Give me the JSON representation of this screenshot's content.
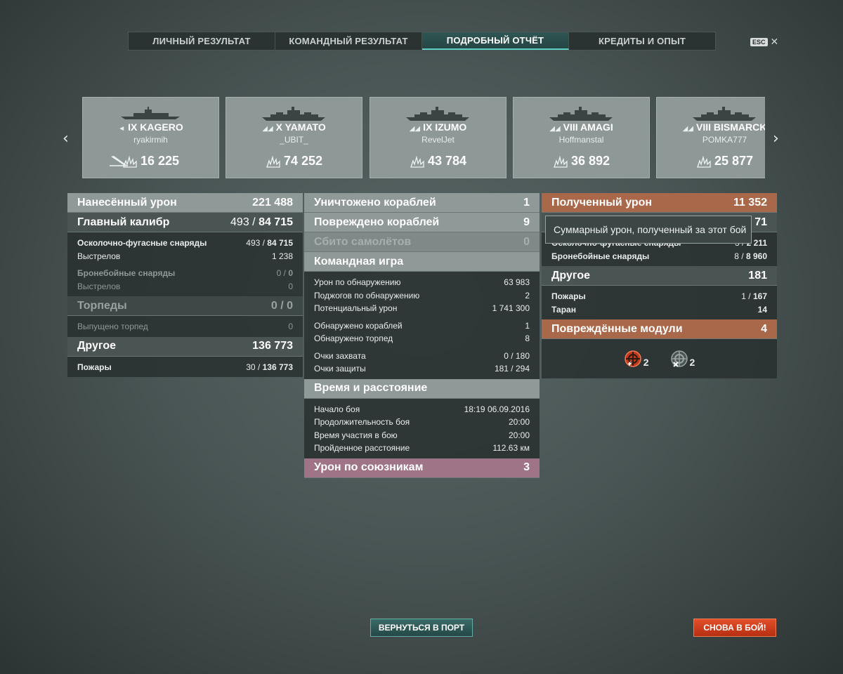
{
  "tabs": [
    "ЛИЧНЫЙ РЕЗУЛЬТАТ",
    "КОМАНДНЫЙ РЕЗУЛЬТАТ",
    "ПОДРОБНЫЙ ОТЧЁТ",
    "КРЕДИТЫ И ОПЫТ"
  ],
  "active_tab": "ПОДРОБНЫЙ ОТЧЁТ",
  "esc_label": "ESC",
  "cards": [
    {
      "tier": "IX",
      "name": "KAGERO",
      "player": "ryakirmih",
      "damage": "16 225",
      "icon": "destroyer-icon"
    },
    {
      "tier": "X",
      "name": "YAMATO",
      "player": "_UBIT_",
      "damage": "74 252",
      "icon": "battleship-icon"
    },
    {
      "tier": "IX",
      "name": "IZUMO",
      "player": "RevelJet",
      "damage": "43 784",
      "icon": "battleship-icon"
    },
    {
      "tier": "VIII",
      "name": "AMAGI",
      "player": "Hoffmanstal",
      "damage": "36 892",
      "icon": "battleship-icon"
    },
    {
      "tier": "VIII",
      "name": "BISMARCK",
      "player": "POMKA777",
      "damage": "25 877",
      "icon": "battleship-icon"
    }
  ],
  "left": {
    "dealt": {
      "label": "Нанесённый урон",
      "value": "221 488"
    },
    "main": {
      "label": "Главный калибр",
      "value_a": "493 / ",
      "value_b": "84 715"
    },
    "he": {
      "label": "Осколочно-фугасные снаряды",
      "value_a": "493 / ",
      "value_b": "84 715"
    },
    "he_shots": {
      "label": "Выстрелов",
      "value": "1 238"
    },
    "ap": {
      "label": "Бронебойные снаряды",
      "value_a": "0 / ",
      "value_b": "0"
    },
    "ap_shots": {
      "label": "Выстрелов",
      "value": "0"
    },
    "torp": {
      "label": "Торпеды",
      "value": "0 / 0"
    },
    "torp_fired": {
      "label": "Выпущено торпед",
      "value": "0"
    },
    "other": {
      "label": "Другое",
      "value": "136 773"
    },
    "fires": {
      "label": "Пожары",
      "value_a": "30 / ",
      "value_b": "136 773"
    }
  },
  "middle": {
    "destroyed": {
      "label": "Уничтожено кораблей",
      "value": "1"
    },
    "damaged": {
      "label": "Повреждено кораблей",
      "value": "9"
    },
    "planes": {
      "label": "Сбито самолётов",
      "value": "0"
    },
    "team": {
      "label": "Командная игра"
    },
    "team_rows": [
      {
        "label": "Урон по обнаружению",
        "value": "63 983"
      },
      {
        "label": "Поджогов по обнаружению",
        "value": "2"
      },
      {
        "label": "Потенциальный урон",
        "value": "1 741 300"
      },
      {
        "label": "Обнаружено кораблей",
        "value": "1"
      },
      {
        "label": "Обнаружено торпед",
        "value": "8"
      },
      {
        "label": "Очки захвата",
        "value": "0 / 180"
      },
      {
        "label": "Очки защиты",
        "value": "181 / 294"
      }
    ],
    "time": {
      "label": "Время и расстояние"
    },
    "time_rows": [
      {
        "label": "Начало боя",
        "value": "18:19  06.09.2016"
      },
      {
        "label": "Продолжительность боя",
        "value": "20:00"
      },
      {
        "label": "Время участия в бою",
        "value": "20:00"
      },
      {
        "label": "Пройденное расстояние",
        "value": "112.63 км"
      }
    ],
    "allies": {
      "label": "Урон по союзникам",
      "value": "3"
    }
  },
  "right": {
    "received": {
      "label": "Полученный урон",
      "value": "11 352"
    },
    "main_partial": "71",
    "he_row": {
      "label": "Осколочно-фугасные снаряды",
      "value_a": "3 / ",
      "value_b": "2 211"
    },
    "ap_row": {
      "label": "Бронебойные снаряды",
      "value_a": "8 / ",
      "value_b": "8 960"
    },
    "other": {
      "label": "Другое",
      "value": "181"
    },
    "fires": {
      "label": "Пожары",
      "value_a": "1 / ",
      "value_b": "167"
    },
    "ram": {
      "label": "Таран",
      "value": "14"
    },
    "modules": {
      "label": "Повреждённые модули",
      "value": "4"
    },
    "module_counts": [
      {
        "icon": "steering-gear-icon",
        "count": "2"
      },
      {
        "icon": "engine-icon",
        "count": "2"
      }
    ]
  },
  "tooltip": "Суммарный урон, полученный за этот бой",
  "buttons": {
    "port": "ВЕРНУТЬСЯ В ПОРТ",
    "battle": "СНОВА В БОЙ!"
  },
  "colors": {
    "accent": "#5fd0c6",
    "received": "#a9684a",
    "allies": "#a07487",
    "battle_button": "#d4421f"
  }
}
